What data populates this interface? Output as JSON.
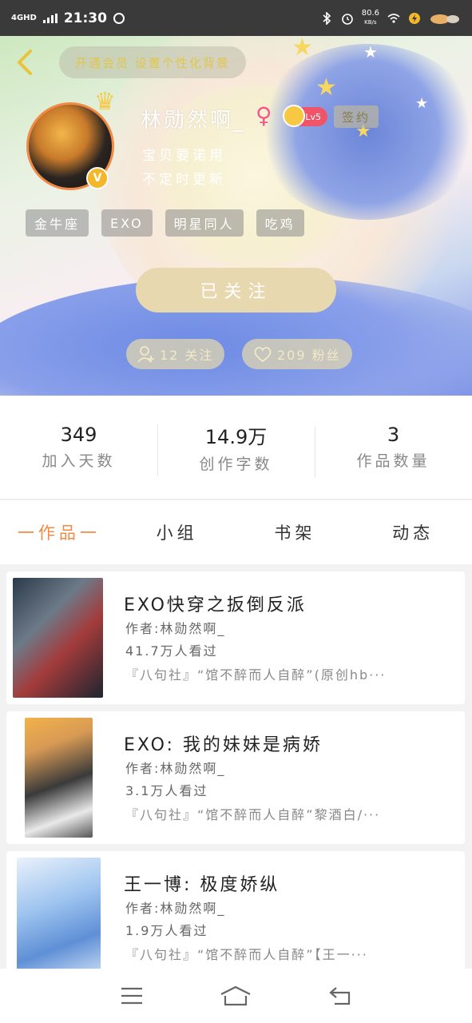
{
  "status_bar": {
    "network": "4GHD",
    "time": "21:30",
    "speed": "80.6",
    "speed_unit": "KB/s"
  },
  "header": {
    "vip_text": "开通会员 设置个性化背景",
    "username": "林勋然啊_",
    "gender": "♀",
    "level": "Lv5",
    "sign_label": "签约",
    "bio_line1": "宝贝要诺用",
    "bio_line2": "不定时更新",
    "verified_badge": "V",
    "tags": [
      "金牛座",
      "EXO",
      "明星同人",
      "吃鸡"
    ],
    "follow_button": "已关注",
    "following": "12 关注",
    "fans": "209 粉丝"
  },
  "stats": [
    {
      "num": "349",
      "label": "加入天数"
    },
    {
      "num": "14.9万",
      "label": "创作字数"
    },
    {
      "num": "3",
      "label": "作品数量"
    }
  ],
  "tabs": [
    "一作品一",
    "小组",
    "书架",
    "动态"
  ],
  "works": [
    {
      "title": "EXO快穿之扳倒反派",
      "author": "作者:林勋然啊_",
      "views": "41.7万人看过",
      "desc": "『八句社』“馆不醉而人自醉”(原创hb···"
    },
    {
      "title": "EXO: 我的妹妹是病娇",
      "author": "作者:林勋然啊_",
      "views": "3.1万人看过",
      "desc": "『八句社』“馆不醉而人自醉”黎酒白/···"
    },
    {
      "title": "王一博: 极度娇纵",
      "author": "作者:林勋然啊_",
      "views": "1.9万人看过",
      "desc": "『八句社』“馆不醉而人自醉”【王一···"
    }
  ],
  "colors": {
    "accent": "#f08a44",
    "follow_button": "#e8d8b0",
    "level_badge": "#f05468",
    "gender": "#ef5a8a"
  },
  "icons": [
    "back-chevron-icon",
    "person-add-icon",
    "heart-icon",
    "menu-icon",
    "home-icon",
    "back-icon",
    "bluetooth-icon",
    "alarm-icon",
    "wifi-icon",
    "battery-icon"
  ]
}
